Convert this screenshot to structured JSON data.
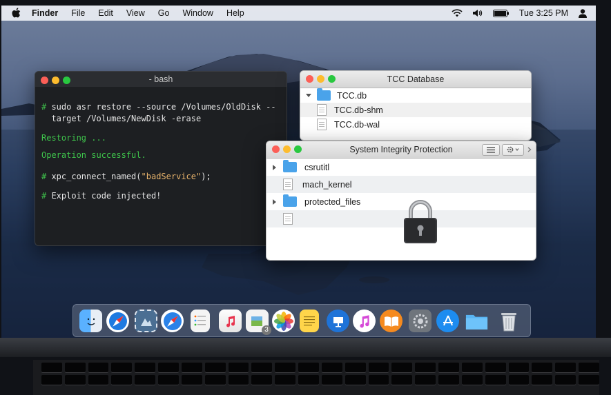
{
  "menubar": {
    "app": "Finder",
    "items": [
      "File",
      "Edit",
      "View",
      "Go",
      "Window",
      "Help"
    ],
    "clock": "Tue 3:25 PM",
    "icons": [
      "apple-icon",
      "wifi-icon",
      "volume-icon",
      "battery-icon",
      "user-icon"
    ]
  },
  "terminal": {
    "title": "- bash",
    "cmd1a": "# sudo asr restore --source /Volumes/OldDisk --",
    "cmd1b": "  target /Volumes/NewDisk -erase",
    "restoring": "Restoring ...",
    "success": "Operation successful.",
    "cmd2_prefix": "# xpc_connect_named(",
    "cmd2_str": "\"badService\"",
    "cmd2_suffix": ");",
    "cmd3": "# Exploit code injected!",
    "colors": {
      "prompt": "#3ec24b",
      "string": "#e9b46c",
      "text": "#e4e4e4"
    }
  },
  "tcc_window": {
    "title": "TCC Database",
    "items": [
      {
        "name": "TCC.db",
        "type": "folder",
        "expanded": true
      },
      {
        "name": "TCC.db-shm",
        "type": "file"
      },
      {
        "name": "TCC.db-wal",
        "type": "file"
      }
    ]
  },
  "sip_window": {
    "title": "System Integrity Protection",
    "items": [
      {
        "name": "csrutitl",
        "type": "folder"
      },
      {
        "name": "mach_kernel",
        "type": "file"
      },
      {
        "name": "protected_files",
        "type": "folder"
      },
      {
        "name": "",
        "type": "file"
      }
    ],
    "toolbar_icons": [
      "list-view-icon",
      "gear-icon",
      "chevron-right-icon"
    ],
    "overlay_icon": "padlock-icon"
  },
  "dock": {
    "icons": [
      "finder-icon",
      "safari-icon",
      "mail-stamp-icon",
      "safari-compass-icon",
      "reminders-icon",
      "music-store-icon",
      "preview-icon",
      "photos-icon",
      "notes-icon",
      "keynote-icon",
      "itunes-icon",
      "books-icon",
      "system-preferences-icon",
      "app-store-icon",
      "folder-icon",
      "trash-icon"
    ],
    "badge": "3"
  },
  "accent_colors": {
    "folder_blue": "#4aa3ea",
    "close": "#fc5f57",
    "minimize": "#fdbc2e",
    "zoom": "#29c840"
  }
}
